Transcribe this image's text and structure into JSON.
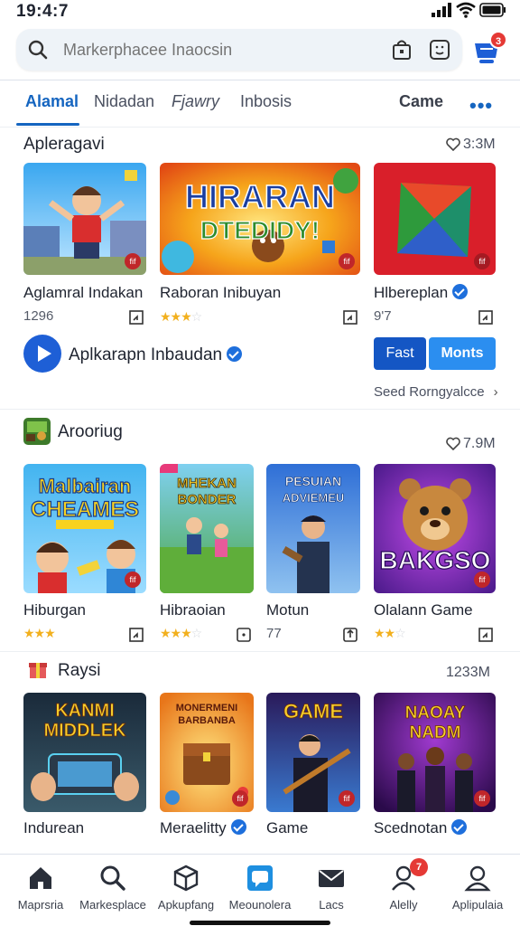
{
  "status_bar": {
    "time": "19:4:7"
  },
  "search": {
    "placeholder": "Markerphacee Inaocsin",
    "notification_count": "3"
  },
  "tabs": [
    {
      "label": "Alamal",
      "active": true
    },
    {
      "label": "Nidadan"
    },
    {
      "label": "Fjawry"
    },
    {
      "label": "Inbosis"
    },
    {
      "label": "Came"
    }
  ],
  "section1": {
    "title": "Apleragavi",
    "meta": "3:3M",
    "cards": [
      {
        "title": "Aglamral Indakan",
        "sub": "1296",
        "corner": "fif"
      },
      {
        "title": "Raboran Inibuyan",
        "rating": 3,
        "art_text": "HIRARAN DTEDIDY!",
        "corner": "fif"
      },
      {
        "title": "Hlbereplan",
        "sub": "9'7",
        "verified": true,
        "corner": "fif"
      }
    ],
    "promo_label": "Aplkarapn Inbaudan",
    "buttons": {
      "fast": "Fast",
      "monts": "Monts"
    },
    "see_more": "Seed Rorngyalcce"
  },
  "section2": {
    "title": "Arooriug",
    "meta": "7.9M",
    "cards": [
      {
        "title": "Hiburgan",
        "rating": 3,
        "art_text": "Malbairan CHEAMES",
        "corner": "fif"
      },
      {
        "title": "Hibraoian",
        "rating": 3,
        "art_text": "MHEKAN BONDER"
      },
      {
        "title": "Motun",
        "sub": "77",
        "art_text": "PESUIAN ADVIEMEU"
      },
      {
        "title": "Olalann Game",
        "rating": 2,
        "art_text": "BAKGSO",
        "corner": "fif"
      }
    ]
  },
  "section3": {
    "title": "Raysi",
    "meta": "1233M",
    "cards": [
      {
        "title": "Indurean",
        "art_text": "KANMI MIDDLEK"
      },
      {
        "title": "Meraelitty",
        "verified": true,
        "art_text": "MONERMENI BARBANBA",
        "corner": "fif"
      },
      {
        "title": "Game",
        "art_text": "GAME",
        "corner": "fif"
      },
      {
        "title": "Scednotan",
        "verified": true,
        "art_text": "NAOAY NADM",
        "corner": "fif"
      }
    ]
  },
  "bottom_nav": [
    {
      "label": "Maprsria",
      "icon": "home-icon"
    },
    {
      "label": "Markesplace",
      "icon": "search-icon"
    },
    {
      "label": "Apkupfang",
      "icon": "box-icon"
    },
    {
      "label": "Meounolera",
      "icon": "chat-icon",
      "active": true
    },
    {
      "label": "Lacs",
      "icon": "mail-icon"
    },
    {
      "label": "Alelly",
      "icon": "user-icon",
      "badge": "7"
    },
    {
      "label": "Aplipulaia",
      "icon": "profile-icon"
    }
  ],
  "colors": {
    "accent": "#1565c0",
    "badge": "#e53935",
    "star": "#f2b01e"
  }
}
